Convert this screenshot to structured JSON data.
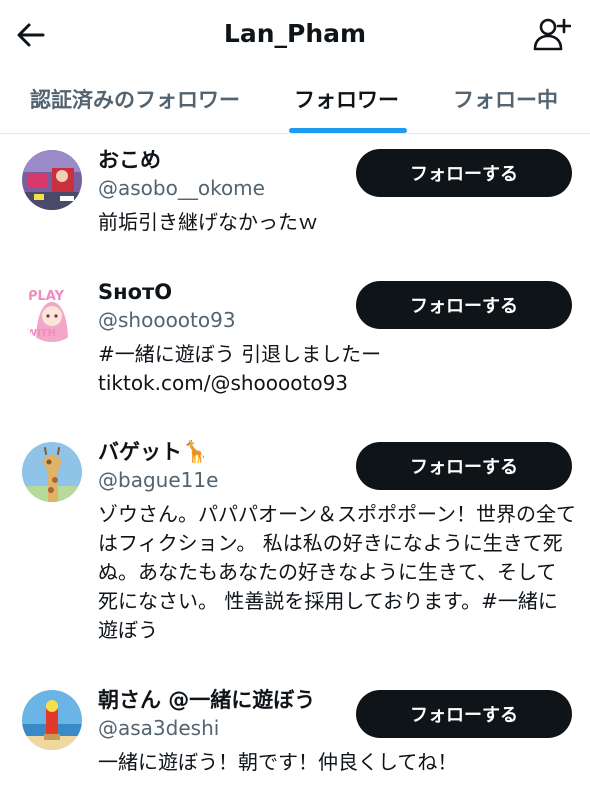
{
  "header": {
    "title": "Lan_Pham",
    "back_icon": "arrow-left-icon",
    "add_icon": "person-plus-icon"
  },
  "tabs": [
    {
      "label": "認証済みのフォロワー",
      "active": false
    },
    {
      "label": "フォロワー",
      "active": true
    },
    {
      "label": "フォロー中",
      "active": false
    }
  ],
  "colors": {
    "accent": "#1d9bf0",
    "button_bg": "#0f1419",
    "secondary_text": "#536471"
  },
  "users": [
    {
      "name": "おこめ",
      "handle": "@asobo__okome",
      "bio": "前垢引き継げなかったｗ",
      "button_label": "フォローする",
      "avatar_icon": "game-scene-avatar"
    },
    {
      "name": "SʜᴏᴛO",
      "handle": "@shooooto93",
      "bio": "#一緒に遊ぼう 引退しましたー tiktok.com/@shooooto93",
      "button_label": "フォローする",
      "avatar_icon": "anime-girl-avatar"
    },
    {
      "name": "バゲット🦒",
      "handle": "@bague11e",
      "bio": "ゾウさん。パパパオーン＆スポポポーン！世界の全てはフィクション。 私は私の好きになように生きて死ぬ。あなたもあなたの好きなように生きて、そして死になさい。 性善説を採用しております。#一緒に遊ぼう",
      "button_label": "フォローする",
      "avatar_icon": "giraffe-avatar"
    },
    {
      "name": "朝さん @一緒に遊ぼう",
      "handle": "@asa3deshi",
      "bio": "一緒に遊ぼう！朝です！仲良くしてね！",
      "button_label": "フォローする",
      "avatar_icon": "beach-character-avatar"
    }
  ]
}
